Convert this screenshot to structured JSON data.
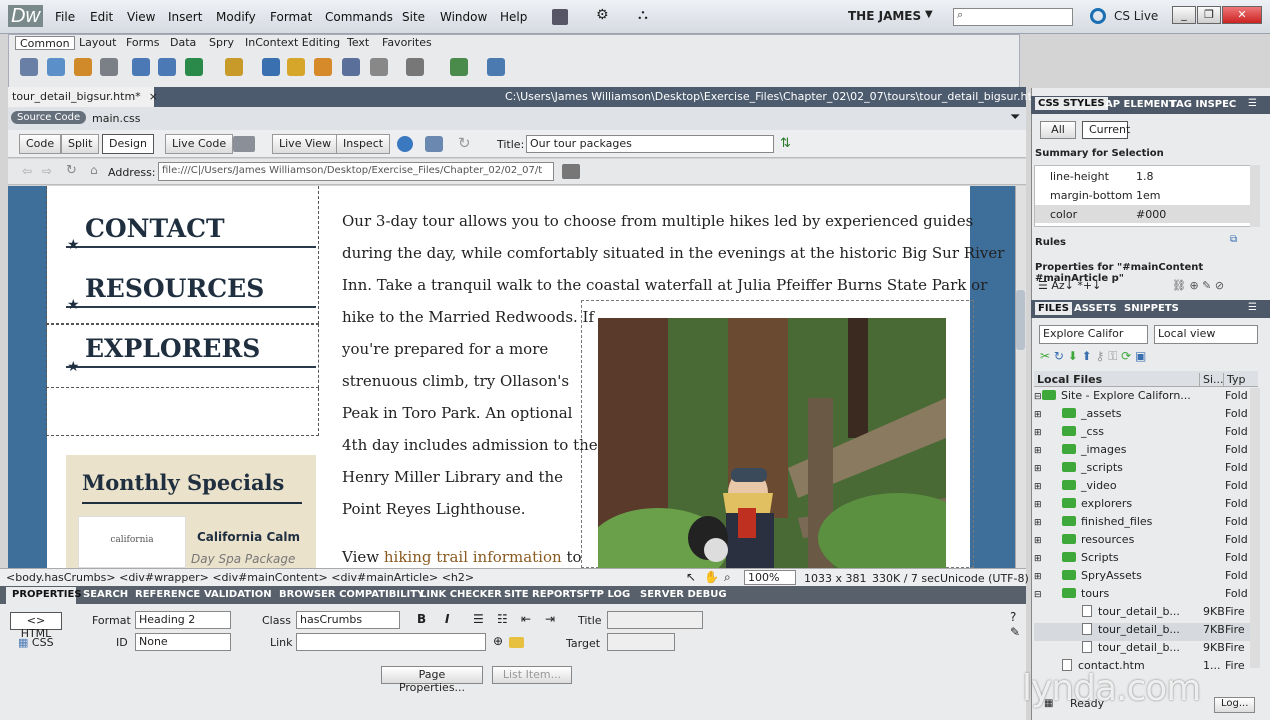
{
  "app": {
    "logo": "Dw",
    "workspace": "THE JAMES",
    "cs_live": "CS Live"
  },
  "menu": [
    "File",
    "Edit",
    "View",
    "Insert",
    "Modify",
    "Format",
    "Commands",
    "Site",
    "Window",
    "Help"
  ],
  "insert_tabs": [
    "Common",
    "Layout",
    "Forms",
    "Data",
    "Spry",
    "InContext Editing",
    "Text",
    "Favorites"
  ],
  "document": {
    "tab": "tour_detail_bigsur.htm*",
    "path": "C:\\Users\\James Williamson\\Desktop\\Exercise_Files\\Chapter_02\\02_07\\tours\\tour_detail_bigsur.htm",
    "source_code": "Source Code",
    "related_file": "main.css"
  },
  "view_toolbar": {
    "code": "Code",
    "split": "Split",
    "design": "Design",
    "live_code": "Live Code",
    "live_view": "Live View",
    "inspect": "Inspect",
    "title_label": "Title:",
    "title_value": "Our tour packages"
  },
  "address": {
    "label": "Address:",
    "value": "file:///C|/Users/James Williamson/Desktop/Exercise_Files/Chapter_02/02_07/t"
  },
  "nav": [
    "CONTACT",
    "RESOURCES",
    "EXPLORERS"
  ],
  "specials": {
    "title": "Monthly Specials",
    "item": "California Calm",
    "sub": "Day Spa Package",
    "seal": "california"
  },
  "copy": {
    "lines_full": [
      "Our 3-day tour allows you to choose from multiple hikes led by experienced guides",
      "during the day, while comfortably situated in the evenings at the historic Big Sur River",
      "Inn. Take a tranquil walk to the coastal waterfall at Julia Pfeiffer Burns State Park or"
    ],
    "lines_narrow": [
      "hike to the Married Redwoods. If",
      "you're prepared for a more",
      "strenuous climb, try Ollason's",
      "Peak in Toro Park. An optional",
      "4th day includes admission to the",
      "Henry Miller Library and the",
      "Point Reyes Lighthouse."
    ],
    "view_prefix": "View",
    "view_link": "hiking trail information",
    "view_suffix": "to"
  },
  "status": {
    "crumbs": "<body.hasCrumbs> <div#wrapper> <div#mainContent> <div#mainArticle> <h2>",
    "zoom": "100%",
    "dims": "1033 x 381",
    "size": "330K / 7 sec",
    "encoding": "Unicode (UTF-8)"
  },
  "panel_tabs": [
    "PROPERTIES",
    "SEARCH",
    "REFERENCE",
    "VALIDATION",
    "BROWSER COMPATIBILITY",
    "LINK CHECKER",
    "SITE REPORTS",
    "FTP LOG",
    "SERVER DEBUG"
  ],
  "properties": {
    "html": "HTML",
    "css": "CSS",
    "format_label": "Format",
    "format_value": "Heading 2",
    "id_label": "ID",
    "id_value": "None",
    "class_label": "Class",
    "class_value": "hasCrumbs",
    "link_label": "Link",
    "title_label": "Title",
    "target_label": "Target",
    "page_props": "Page Properties...",
    "list_item": "List Item...",
    "bold": "B",
    "italic": "I"
  },
  "css_panel": {
    "tabs": [
      "CSS STYLES",
      "AP ELEMENT",
      "TAG INSPEC"
    ],
    "all": "All",
    "current": "Current",
    "summary": "Summary for Selection",
    "props": [
      {
        "name": "line-height",
        "value": "1.8"
      },
      {
        "name": "margin-bottom",
        "value": "1em"
      },
      {
        "name": "color",
        "value": "#000"
      }
    ],
    "rules": "Rules",
    "properties_for": "Properties for \"#mainContent #mainArticle p\""
  },
  "files_panel": {
    "tabs": [
      "FILES",
      "ASSETS",
      "SNIPPETS"
    ],
    "site": "Explore Califor",
    "view": "Local view",
    "col_local": "Local Files",
    "col_size": "Si...",
    "col_type": "Typ",
    "rows": [
      {
        "name": "Site - Explore Californ...",
        "size": "",
        "type": "Fold",
        "level": 0,
        "kind": "folder"
      },
      {
        "name": "_assets",
        "size": "",
        "type": "Fold",
        "level": 1,
        "kind": "folder"
      },
      {
        "name": "_css",
        "size": "",
        "type": "Fold",
        "level": 1,
        "kind": "folder"
      },
      {
        "name": "_images",
        "size": "",
        "type": "Fold",
        "level": 1,
        "kind": "folder"
      },
      {
        "name": "_scripts",
        "size": "",
        "type": "Fold",
        "level": 1,
        "kind": "folder"
      },
      {
        "name": "_video",
        "size": "",
        "type": "Fold",
        "level": 1,
        "kind": "folder"
      },
      {
        "name": "explorers",
        "size": "",
        "type": "Fold",
        "level": 1,
        "kind": "folder"
      },
      {
        "name": "finished_files",
        "size": "",
        "type": "Fold",
        "level": 1,
        "kind": "folder"
      },
      {
        "name": "resources",
        "size": "",
        "type": "Fold",
        "level": 1,
        "kind": "folder"
      },
      {
        "name": "Scripts",
        "size": "",
        "type": "Fold",
        "level": 1,
        "kind": "folder"
      },
      {
        "name": "SpryAssets",
        "size": "",
        "type": "Fold",
        "level": 1,
        "kind": "folder"
      },
      {
        "name": "tours",
        "size": "",
        "type": "Fold",
        "level": 1,
        "kind": "folder"
      },
      {
        "name": "tour_detail_b...",
        "size": "9KB",
        "type": "Fire",
        "level": 2,
        "kind": "file"
      },
      {
        "name": "tour_detail_b...",
        "size": "7KB",
        "type": "Fire",
        "level": 2,
        "kind": "file"
      },
      {
        "name": "tour_detail_b...",
        "size": "9KB",
        "type": "Fire",
        "level": 2,
        "kind": "file"
      },
      {
        "name": "contact.htm",
        "size": "1...",
        "type": "Fire",
        "level": 1,
        "kind": "file"
      }
    ],
    "ready": "Ready",
    "log": "Log..."
  },
  "watermark": "lynda.com"
}
